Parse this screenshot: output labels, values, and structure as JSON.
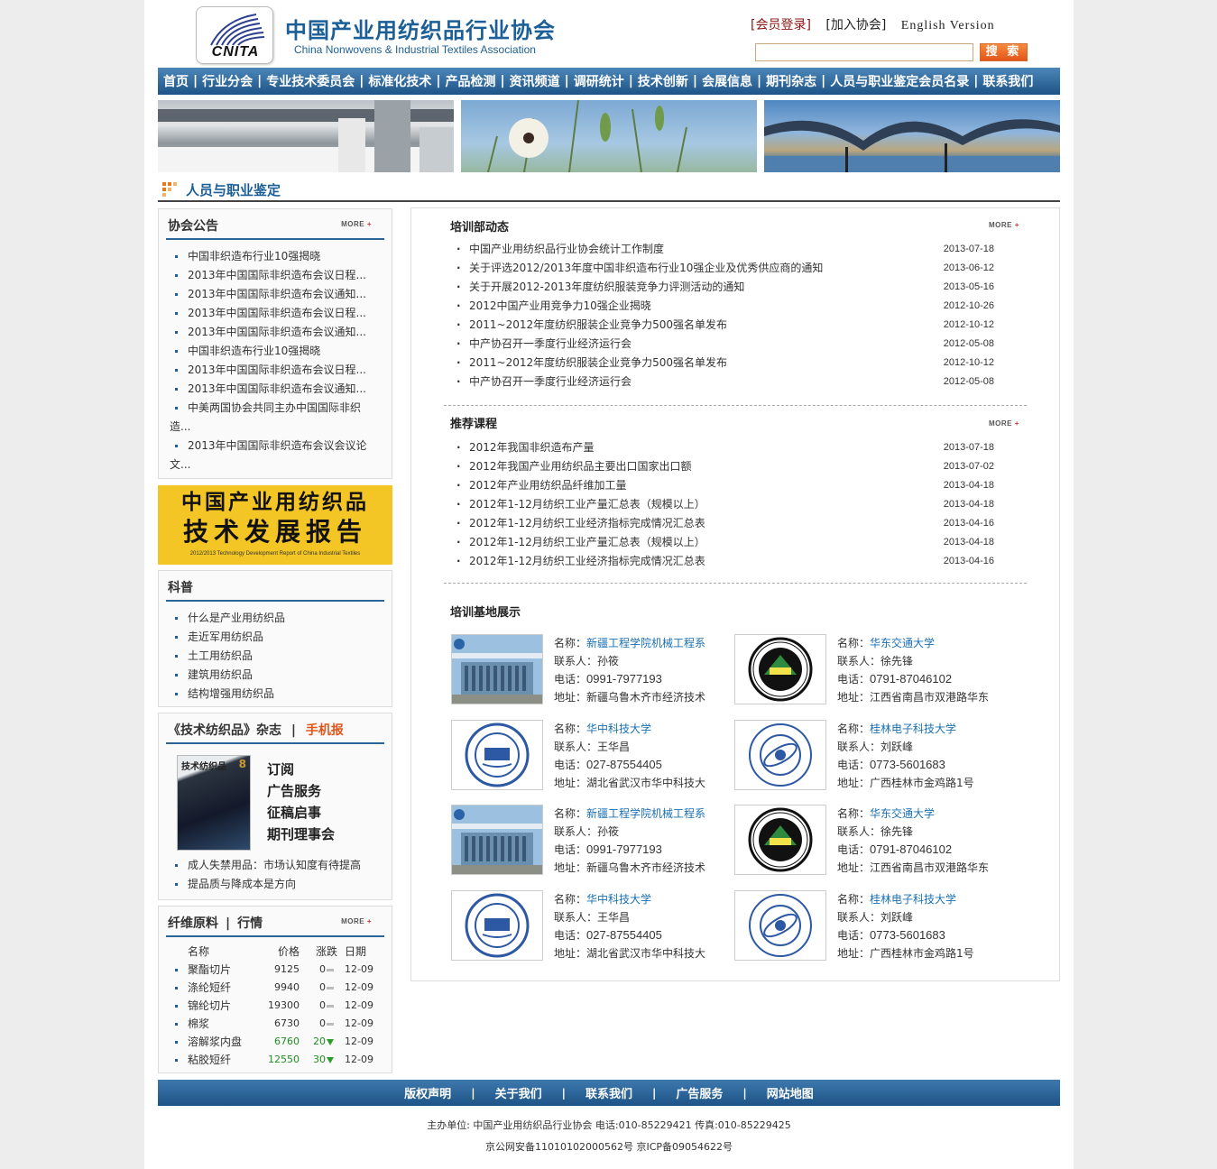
{
  "header": {
    "logo_text": "CNITA",
    "org_name_cn": "中国产业用纺织品行业协会",
    "org_name_en": "China Nonwovens & Industrial Textiles Association",
    "links": [
      "[会员登录]",
      "[加入协会]",
      "English Version"
    ],
    "search_button": "搜 索",
    "search_value": ""
  },
  "nav": [
    "首页",
    "行业分会",
    "专业技术委员会",
    "标准化技术",
    "产品检测",
    "资讯频道",
    "调研统计",
    "技术创新",
    "会展信息",
    "期刊杂志",
    "人员与职业鉴定会员名录",
    "联系我们"
  ],
  "section_title": "人员与职业鉴定",
  "more_label": "MORE",
  "notice": {
    "title": "协会公告",
    "items": [
      "中国非织造布行业10强揭晓",
      "2013年中国国际非织造布会议日程...",
      "2013年中国国际非织造布会议通知...",
      "2013年中国国际非织造布会议日程...",
      "2013年中国国际非织造布会议通知...",
      "中国非织造布行业10强揭晓",
      "2013年中国国际非织造布会议日程...",
      "2013年中国国际非织造布会议通知..."
    ],
    "wrapped": [
      {
        "line1": "中美两国协会共同主办中国国际非织",
        "line2": "造..."
      },
      {
        "line1": "2013年中国国际非织造布会议会议论",
        "line2": "文..."
      }
    ]
  },
  "ad": {
    "line1": "中国产业用纺织品",
    "line2": "技术发展报告",
    "line3": "2012/2013 Technology Development Report of China Industrial Textiles"
  },
  "science": {
    "title": "科普",
    "items": [
      "什么是产业用纺织品",
      "走近军用纺织品",
      "土工用纺织品",
      "建筑用纺织品",
      "结构增强用纺织品"
    ]
  },
  "magazine": {
    "title": "《技术纺织品》杂志",
    "title_sep": "|",
    "mobile": "手机报",
    "cover_title": "技术纺织品",
    "cover_issue": "8",
    "links": [
      "订阅",
      "广告服务",
      "征稿启事",
      "期刊理事会"
    ],
    "items": [
      "成人失禁用品：市场认知度有待提高",
      "提品质与降成本是方向"
    ]
  },
  "prices": {
    "title_a": "纤维原料",
    "title_sep": "|",
    "title_b": "行情",
    "headers": [
      "名称",
      "价格",
      "涨跌",
      "日期"
    ],
    "rows": [
      {
        "name": "聚酯切片",
        "price": "9125",
        "change": "0",
        "date": "12-09",
        "trend": "flat"
      },
      {
        "name": "涤纶短纤",
        "price": "9940",
        "change": "0",
        "date": "12-09",
        "trend": "flat"
      },
      {
        "name": "锦纶切片",
        "price": "19300",
        "change": "0",
        "date": "12-09",
        "trend": "flat"
      },
      {
        "name": "棉浆",
        "price": "6730",
        "change": "0",
        "date": "12-09",
        "trend": "flat"
      },
      {
        "name": "溶解浆内盘",
        "price": "6760",
        "change": "20",
        "date": "12-09",
        "trend": "down"
      },
      {
        "name": "粘胶短纤",
        "price": "12550",
        "change": "30",
        "date": "12-09",
        "trend": "down"
      }
    ]
  },
  "training": {
    "title": "培训部动态",
    "items": [
      {
        "title": "中国产业用纺织品行业协会统计工作制度",
        "date": "2013-07-18"
      },
      {
        "title": "关于评选2012/2013年度中国非织造布行业10强企业及优秀供应商的通知",
        "date": "2013-06-12"
      },
      {
        "title": "关于开展2012-2013年度纺织服装竞争力评测活动的通知",
        "date": "2013-05-16"
      },
      {
        "title": "2012中国产业用竞争力10强企业揭晓",
        "date": "2012-10-26"
      },
      {
        "title": "2011~2012年度纺织服装企业竞争力500强名单发布",
        "date": "2012-10-12"
      },
      {
        "title": "中产协召开一季度行业经济运行会",
        "date": "2012-05-08"
      },
      {
        "title": "2011~2012年度纺织服装企业竞争力500强名单发布",
        "date": "2012-10-12"
      },
      {
        "title": "中产协召开一季度行业经济运行会",
        "date": "2012-05-08"
      }
    ]
  },
  "courses": {
    "title": "推荐课程",
    "items": [
      {
        "title": "2012年我国非织造布产量",
        "date": "2013-07-18"
      },
      {
        "title": "2012年我国产业用纺织品主要出口国家出口额",
        "date": "2013-07-02"
      },
      {
        "title": "2012年产业用纺织品纤维加工量",
        "date": "2013-04-18"
      },
      {
        "title": "2012年1-12月纺织工业产量汇总表（规模以上）",
        "date": "2013-04-18"
      },
      {
        "title": "2012年1-12月纺织工业经济指标完成情况汇总表",
        "date": "2013-04-16"
      },
      {
        "title": "2012年1-12月纺织工业产量汇总表（规模以上）",
        "date": "2013-04-18"
      },
      {
        "title": "2012年1-12月纺织工业经济指标完成情况汇总表",
        "date": "2013-04-16"
      }
    ]
  },
  "bases": {
    "title": "培训基地展示",
    "labels": {
      "name": "名称：",
      "contact": "联系人：",
      "phone": "电话：",
      "address": "地址："
    },
    "items": [
      {
        "name": "新疆工程学院机械工程系",
        "contact": "孙筱",
        "phone": "0991-7977193",
        "address": "新疆乌鲁木齐市经济技术",
        "logo": "xinjiang-college-photo"
      },
      {
        "name": "华东交通大学",
        "contact": "徐先锋",
        "phone": "0791-87046102",
        "address": "江西省南昌市双港路华东",
        "logo": "ecjtu-seal"
      },
      {
        "name": "华中科技大学",
        "contact": "王华昌",
        "phone": "027-87554405",
        "address": "湖北省武汉市华中科技大",
        "logo": "hust-seal"
      },
      {
        "name": "桂林电子科技大学",
        "contact": "刘跃峰",
        "phone": "0773-5601683",
        "address": "广西桂林市金鸡路1号",
        "logo": "guet-seal"
      },
      {
        "name": "新疆工程学院机械工程系",
        "contact": "孙筱",
        "phone": "0991-7977193",
        "address": "新疆乌鲁木齐市经济技术",
        "logo": "xinjiang-college-photo"
      },
      {
        "name": "华东交通大学",
        "contact": "徐先锋",
        "phone": "0791-87046102",
        "address": "江西省南昌市双港路华东",
        "logo": "ecjtu-seal"
      },
      {
        "name": "华中科技大学",
        "contact": "王华昌",
        "phone": "027-87554405",
        "address": "湖北省武汉市华中科技大",
        "logo": "hust-seal"
      },
      {
        "name": "桂林电子科技大学",
        "contact": "刘跃峰",
        "phone": "0773-5601683",
        "address": "广西桂林市金鸡路1号",
        "logo": "guet-seal"
      }
    ]
  },
  "footer": {
    "links": [
      "版权声明",
      "关于我们",
      "联系我们",
      "广告服务",
      "网站地图"
    ],
    "line1": "主办单位: 中国产业用纺织品行业协会 电话:010-85229421 传真:010-85229425",
    "line2": "京公网安备11010102000562号 京ICP备09054622号"
  },
  "colors": {
    "brand_blue": "#1c5f96",
    "nav_blue": "#1e5487",
    "accent_orange": "#e2551a",
    "ad_yellow": "#f4c625",
    "link_blue": "#1a70b5"
  }
}
